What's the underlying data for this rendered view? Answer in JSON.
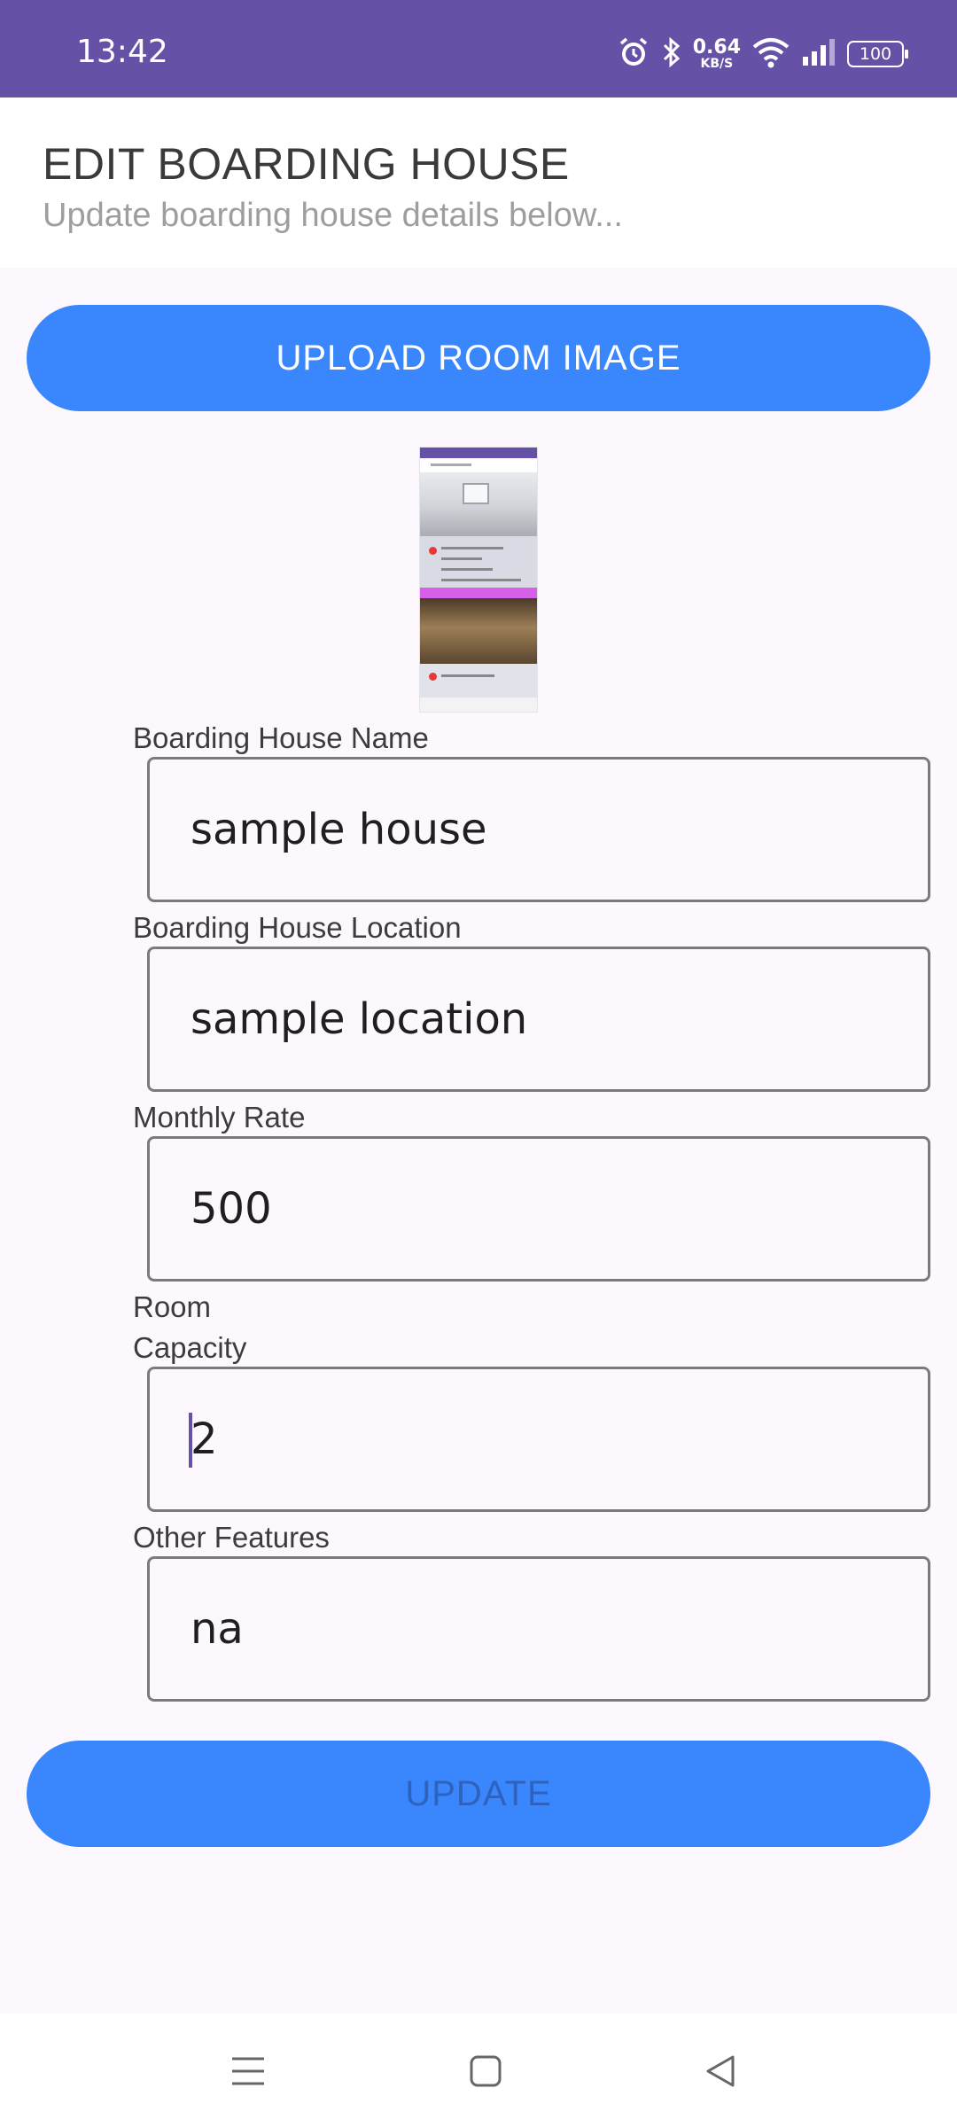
{
  "status_bar": {
    "time": "13:42",
    "speed_value": "0.64",
    "speed_unit": "KB/S",
    "battery": "100",
    "icons": [
      "alarm-icon",
      "bluetooth-icon",
      "wifi-icon",
      "signal-icon",
      "battery-icon"
    ]
  },
  "header": {
    "title": "EDIT BOARDING HOUSE",
    "subtitle": "Update boarding house details below..."
  },
  "upload_button_label": "UPLOAD ROOM IMAGE",
  "fields": {
    "name": {
      "label": "Boarding House Name",
      "value": "sample house"
    },
    "location": {
      "label": "Boarding House Location",
      "value": "sample location"
    },
    "rate": {
      "label": "Monthly Rate",
      "value": "500"
    },
    "capacity": {
      "label_line1": "Room",
      "label_line2": "Capacity",
      "value": "2"
    },
    "features": {
      "label": "Other Features",
      "value": "na"
    }
  },
  "update_button_label": "UPDATE",
  "nav": [
    "menu-icon",
    "home-icon",
    "back-icon"
  ],
  "colors": {
    "status_bar": "#6551a5",
    "primary_button": "#3a86fd",
    "update_text": "#2f62bd",
    "background": "#fdf8fd"
  }
}
